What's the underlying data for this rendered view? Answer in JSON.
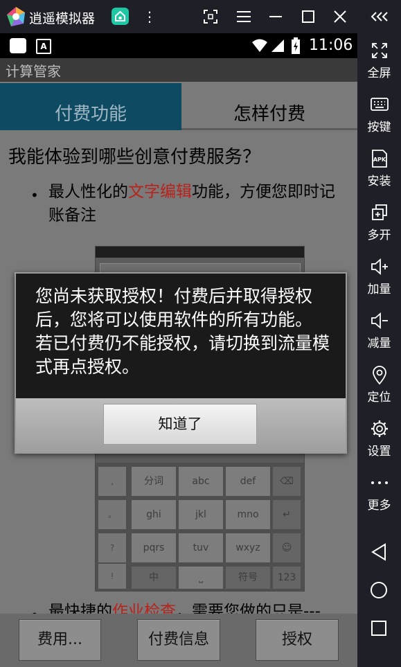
{
  "emulator": {
    "title": "逍遥模拟器",
    "sidebar": [
      {
        "icon": "fullscreen-icon",
        "glyph": "⤢",
        "label": "全屏"
      },
      {
        "icon": "keyboard-icon",
        "glyph": "⌨",
        "label": "按键"
      },
      {
        "icon": "apk-icon",
        "glyph": "APK",
        "label": "安装"
      },
      {
        "icon": "multi-open-icon",
        "glyph": "⧉",
        "label": "多开"
      },
      {
        "icon": "volume-up-icon",
        "glyph": "🔈+",
        "label": "加量"
      },
      {
        "icon": "volume-down-icon",
        "glyph": "🔈-",
        "label": "减量"
      },
      {
        "icon": "location-pin-icon",
        "glyph": "⌖",
        "label": "定位"
      },
      {
        "icon": "gear-icon",
        "glyph": "⚙",
        "label": "设置"
      },
      {
        "icon": "more-icon",
        "glyph": "•••",
        "label": "更多"
      }
    ]
  },
  "status_bar": {
    "time": "11:06"
  },
  "app": {
    "title": "计算管家",
    "tabs": [
      {
        "label": "付费功能",
        "active": true
      },
      {
        "label": "怎样付费",
        "active": false
      }
    ],
    "content": {
      "heading": "我能体验到哪些创意付费服务？",
      "bullet1_pre": "最人性化的",
      "bullet1_highlight": "文字编辑",
      "bullet1_post": "功能，方便您即时记账备注",
      "bullet2_pre": "最快捷的",
      "bullet2_highlight": "作业检查",
      "bullet2_post": "，需要您做的只是---"
    },
    "bottom_buttons": [
      "费用...",
      "付费信息",
      "授权"
    ],
    "highlight_color": "#b8221a"
  },
  "dialog": {
    "message": "您尚未获取授权！付费后并取得授权后，您将可以使用软件的所有功能。 若已付费仍不能授权，请切换到流量模式再点授权。",
    "ok_label": "知道了"
  },
  "keyboard": {
    "left_col": [
      ",",
      "。",
      "?",
      "!",
      "~"
    ],
    "rows": [
      [
        "分词",
        "abc",
        "def"
      ],
      [
        "ghi",
        "jkl",
        "mno"
      ],
      [
        "pqrs",
        "tuv",
        "wxyz"
      ],
      [
        "中",
        "⎵",
        "符号"
      ]
    ],
    "right_col": [
      "⌫",
      "↵",
      "☺",
      "123"
    ]
  }
}
